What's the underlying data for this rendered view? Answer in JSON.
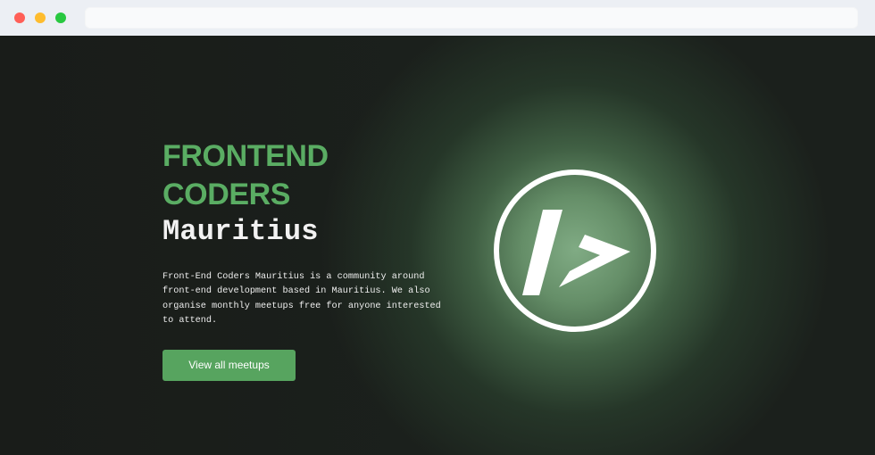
{
  "browser": {
    "address_value": "",
    "controls": [
      "close",
      "minimize",
      "maximize"
    ]
  },
  "hero": {
    "title_line_1": "FRONTEND",
    "title_line_2": "CODERS",
    "subtitle": "Mauritius",
    "description": "Front-End Coders Mauritius is a community around front-end development based in Mauritius. We also organise monthly meetups free for anyone interested to attend.",
    "button_label": "View all meetups"
  },
  "colors": {
    "accent": "#5aad63",
    "button": "#57a45f",
    "background": "#1b201c",
    "glow": "#82ae86"
  },
  "icons": {
    "logo": "frontend-coders-logo-icon"
  }
}
